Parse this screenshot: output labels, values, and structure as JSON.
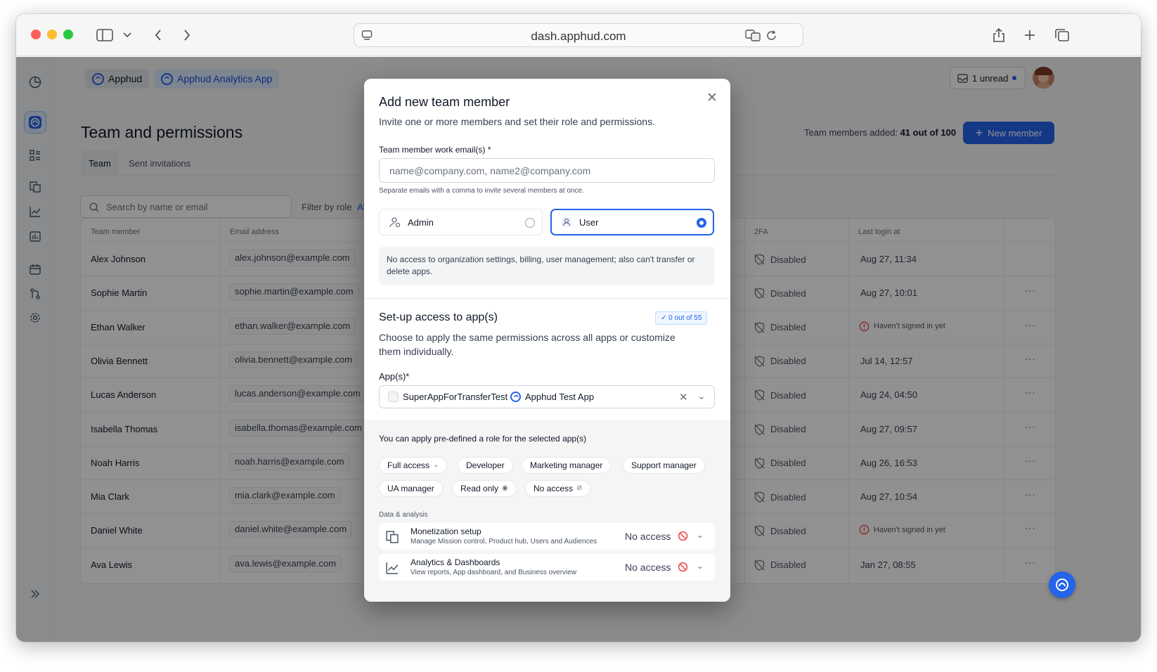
{
  "browser": {
    "url": "dash.apphud.com",
    "traffic_lights": [
      "#ff5f57",
      "#febc2e",
      "#28c840"
    ]
  },
  "header": {
    "org_chip": "Apphud",
    "app_chip": "Apphud Analytics App",
    "inbox": "1 unread",
    "new_member": "New member",
    "members_added_label": "Team members added:",
    "members_added_value": "41 out of 100"
  },
  "page": {
    "title": "Team and permissions",
    "tabs": [
      "Team",
      "Sent invitations"
    ],
    "search_placeholder": "Search by name or email",
    "filter_label": "Filter by role",
    "filter_value": "Al"
  },
  "table": {
    "columns": [
      "Team member",
      "Email address",
      "2FA",
      "Last login at"
    ],
    "rows": [
      {
        "name": "Alex Johnson",
        "email": "alex.johnson@example.com",
        "twofa": "Disabled",
        "login": "Aug 27, 11:34"
      },
      {
        "name": "Sophie Martin",
        "email": "sophie.martin@example.com",
        "twofa": "Disabled",
        "login": "Aug 27, 10:01"
      },
      {
        "name": "Ethan Walker",
        "email": "ethan.walker@example.com",
        "twofa": "Disabled",
        "login": "Haven't signed in yet"
      },
      {
        "name": "Olivia Bennett",
        "email": "olivia.bennett@example.com",
        "twofa": "Disabled",
        "login": "Jul 14, 12:57"
      },
      {
        "name": "Lucas Anderson",
        "email": "lucas.anderson@example.com",
        "twofa": "Disabled",
        "login": "Aug 24, 04:50"
      },
      {
        "name": "Isabella Thomas",
        "email": "isabella.thomas@example.com",
        "twofa": "Disabled",
        "login": "Aug 27, 09:57"
      },
      {
        "name": "Noah Harris",
        "email": "noah.harris@example.com",
        "twofa": "Disabled",
        "login": "Aug 26, 16:53"
      },
      {
        "name": "Mia Clark",
        "email": "mia.clark@example.com",
        "twofa": "Disabled",
        "login": "Aug 27, 10:54"
      },
      {
        "name": "Daniel White",
        "email": "daniel.white@example.com",
        "twofa": "Disabled",
        "login": "Haven't signed in yet"
      },
      {
        "name": "Ava Lewis",
        "email": "ava.lewis@example.com",
        "twofa": "Disabled",
        "login": "Jan 27, 08:55"
      }
    ],
    "more_label": "···"
  },
  "modal": {
    "title": "Add new team member",
    "subtitle": "Invite one or more members and set their role and permissions.",
    "email_label": "Team member work email(s) *",
    "email_placeholder": "name@company.com, name2@company.com",
    "email_hint": "Separate emails with a comma to invite several members at once.",
    "roles": [
      {
        "label": "Admin",
        "selected": false
      },
      {
        "label": "User",
        "selected": true
      }
    ],
    "role_description": "No access to organization settings, billing, user management; also can't transfer or delete apps.",
    "access_title": "Set-up access to app(s)",
    "access_badge": "0 out of 55",
    "access_desc": "Choose to apply the same permissions across all apps or customize them individually.",
    "apps_label": "App(s)*",
    "selected_apps": [
      "SuperAppForTransferTest",
      "Apphud Test App"
    ],
    "predefined_title": "You can apply pre-defined a role for the selected app(s)",
    "predefined_roles": [
      "Full access",
      "Developer",
      "Marketing manager",
      "Support manager",
      "UA manager",
      "Read only",
      "No access"
    ],
    "section_label": "Data & analysis",
    "permissions": [
      {
        "title": "Monetization setup",
        "desc": "Manage Mission control, Product hub, Users and Audiences",
        "value": "No access"
      },
      {
        "title": "Analytics & Dashboards",
        "desc": "View reports, App dashboard, and Business overview",
        "value": "No access"
      }
    ]
  },
  "colors": {
    "accent": "#2563eb",
    "danger": "#ef4444",
    "overlay": "rgba(0,0,0,0.43)"
  }
}
